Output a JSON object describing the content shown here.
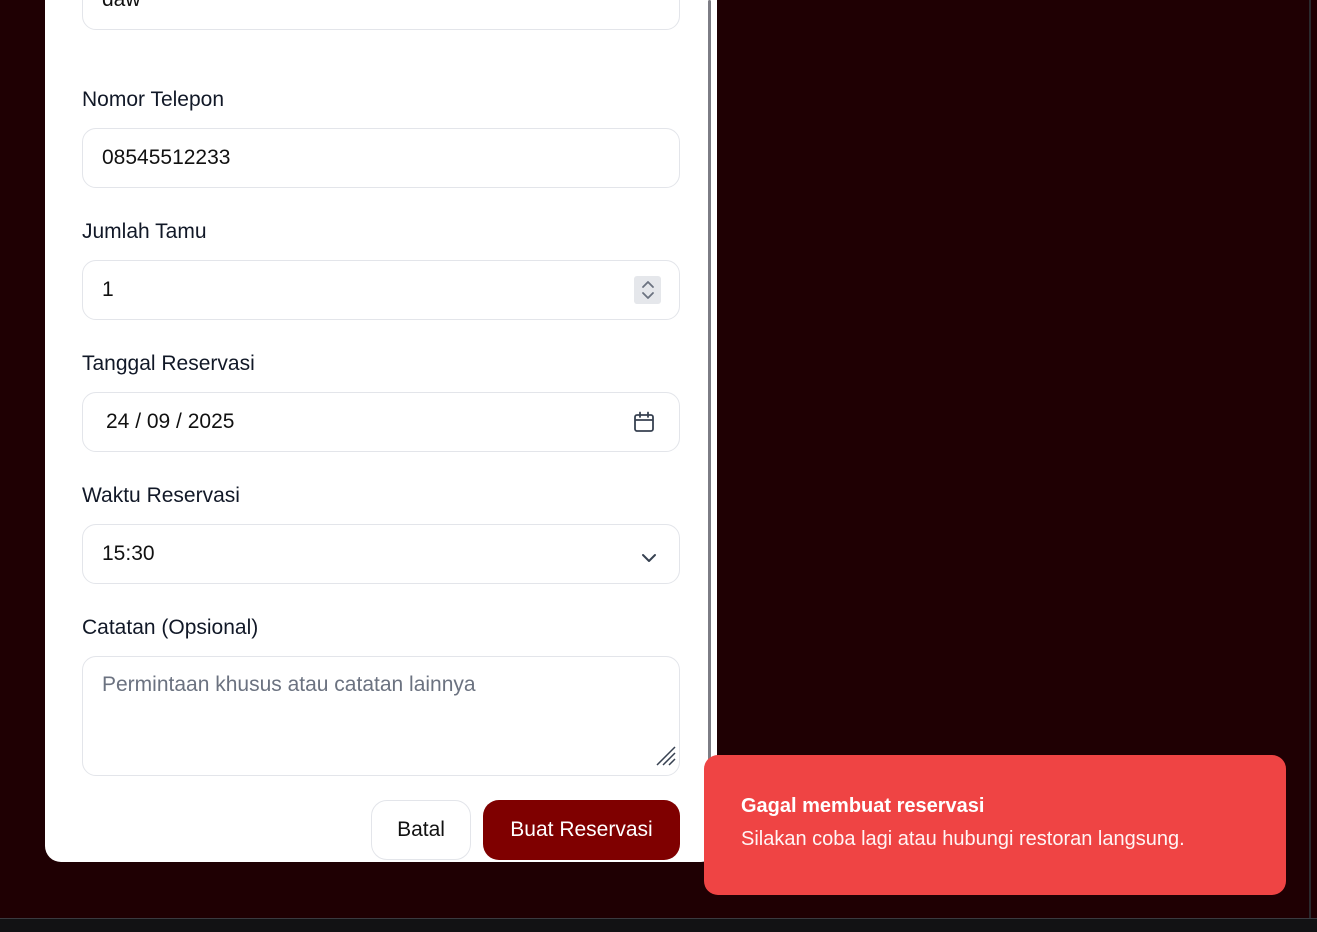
{
  "form": {
    "name_value": "daw",
    "phone": {
      "label": "Nomor Telepon",
      "value": "08545512233"
    },
    "guests": {
      "label": "Jumlah Tamu",
      "value": "1"
    },
    "date": {
      "label": "Tanggal Reservasi",
      "value": "24 / 09 / 2025"
    },
    "time": {
      "label": "Waktu Reservasi",
      "selected": "15:30"
    },
    "notes": {
      "label": "Catatan (Opsional)",
      "placeholder": "Permintaan khusus atau catatan lainnya"
    }
  },
  "buttons": {
    "cancel_label": "Batal",
    "submit_label": "Buat Reservasi"
  },
  "toast": {
    "title": "Gagal membuat reservasi",
    "description": "Silakan coba lagi atau hubungi restoran langsung."
  },
  "colors": {
    "backdrop": "#1f0003",
    "primary": "#7f0000",
    "toast_error": "#ef4444"
  },
  "icons": {
    "spinner": "spinner-arrows-icon",
    "calendar": "calendar-icon",
    "select": "chevron-down-icon",
    "resize": "resize-grip-icon"
  }
}
